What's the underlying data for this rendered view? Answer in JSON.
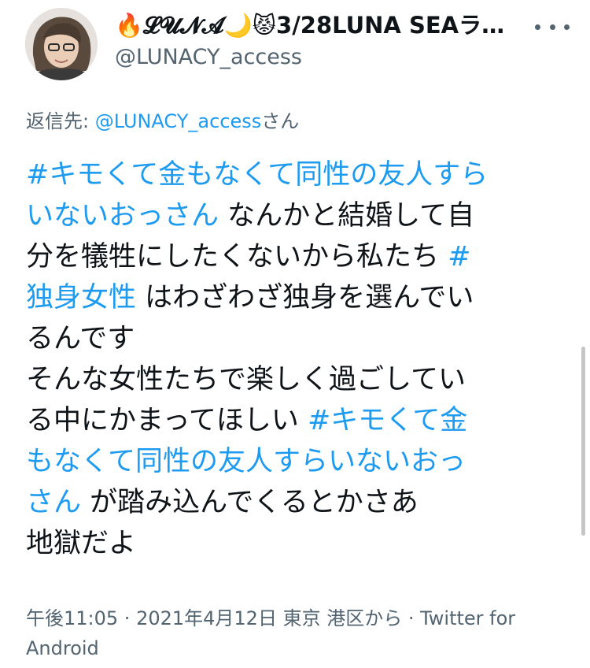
{
  "author": {
    "display_name": "🔥𝓛𝓤𝓝𝓐🌙😾3/28LUNA SEAラ…",
    "handle": "@LUNACY_access"
  },
  "reply": {
    "prefix": "返信先: ",
    "target": "@LUNACY_access",
    "suffix": "さん"
  },
  "tweet": {
    "l1_tag": "#キモくて金もなくて同性の友人すら",
    "l2_tag": "いないおっさん",
    "l2_text": " なんかと結婚して自",
    "l3_text": "分を犠牲にしたくないから私たち ",
    "l3_tag": "#",
    "l4_tag": "独身女性",
    "l4_text": " はわざわざ独身を選んでい",
    "l5_text": "るんです",
    "l6_text": "そんな女性たちで楽しく過ごしてい",
    "l7_text": "る中にかまってほしい ",
    "l7_tag": "#キモくて金",
    "l8_tag": "もなくて同性の友人すらいないおっ",
    "l9_tag": "さん",
    "l9_text": " が踏み込んでくるとかさあ",
    "l10_text": "地獄だよ"
  },
  "meta": {
    "time": "午後11:05",
    "sep1": " · ",
    "date": "2021年4月12日",
    "location": " 東京 港区から",
    "sep2": " · ",
    "source": "Twitter for Android"
  },
  "colors": {
    "link": "#1d9bf0",
    "text": "#0f1419",
    "secondary": "#536471"
  },
  "icons": {
    "more": "more-horizontal-icon"
  }
}
